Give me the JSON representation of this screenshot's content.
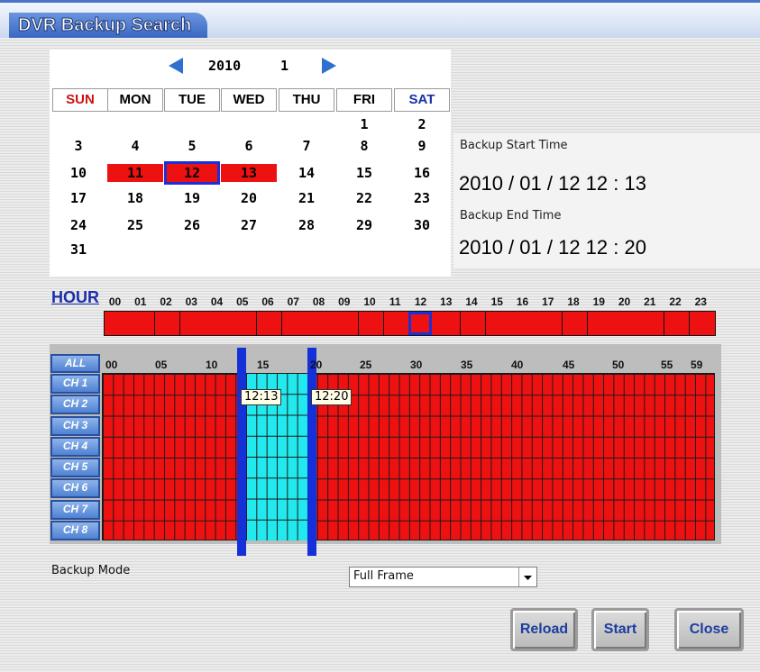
{
  "window": {
    "title": "DVR Backup Search"
  },
  "calendar": {
    "year": "2010",
    "month": "1",
    "weekdays": [
      "SUN",
      "MON",
      "TUE",
      "WED",
      "THU",
      "FRI",
      "SAT"
    ],
    "weeks": [
      [
        "",
        "",
        "",
        "",
        "",
        "1",
        "2"
      ],
      [
        "3",
        "4",
        "5",
        "6",
        "7",
        "8",
        "9"
      ],
      [
        "10",
        "11",
        "12",
        "13",
        "14",
        "15",
        "16"
      ],
      [
        "17",
        "18",
        "19",
        "20",
        "21",
        "22",
        "23"
      ],
      [
        "24",
        "25",
        "26",
        "27",
        "28",
        "29",
        "30"
      ],
      [
        "31",
        "",
        "",
        "",
        "",
        "",
        ""
      ]
    ],
    "days_with_data": [
      "11",
      "12",
      "13"
    ],
    "selected_day": "12",
    "colors": {
      "sunday": "#cc1111",
      "saturday": "#1a2fa8",
      "data": "#ee1111",
      "selection": "#1c2fd8"
    }
  },
  "backup": {
    "start_label": "Backup Start Time",
    "start_value": "2010 / 01 / 12 12 : 13",
    "end_label": "Backup End Time",
    "end_value": "2010 / 01 / 12 12 : 20"
  },
  "hour_bar": {
    "label": "HOUR",
    "hours": [
      "00",
      "01",
      "02",
      "03",
      "04",
      "05",
      "06",
      "07",
      "08",
      "09",
      "10",
      "11",
      "12",
      "13",
      "14",
      "15",
      "16",
      "17",
      "18",
      "19",
      "20",
      "21",
      "22",
      "23"
    ],
    "selected_hour": "12",
    "colors": {
      "record": "#ee1111"
    }
  },
  "minute_grid": {
    "all_label": "ALL",
    "minute_labels": [
      "00",
      "05",
      "10",
      "15",
      "20",
      "25",
      "30",
      "35",
      "40",
      "45",
      "50",
      "55",
      "59"
    ],
    "channels": [
      "CH 1",
      "CH 2",
      "CH 3",
      "CH 4",
      "CH 5",
      "CH 6",
      "CH 7",
      "CH 8"
    ],
    "range_start": "12:13",
    "range_end": "12:20",
    "colors": {
      "record": "#ee1111",
      "selected": "#22e9ee",
      "marker": "#1530d8"
    }
  },
  "backup_mode": {
    "label": "Backup Mode",
    "value": "Full Frame"
  },
  "buttons": {
    "reload": "Reload",
    "start": "Start",
    "close": "Close"
  }
}
